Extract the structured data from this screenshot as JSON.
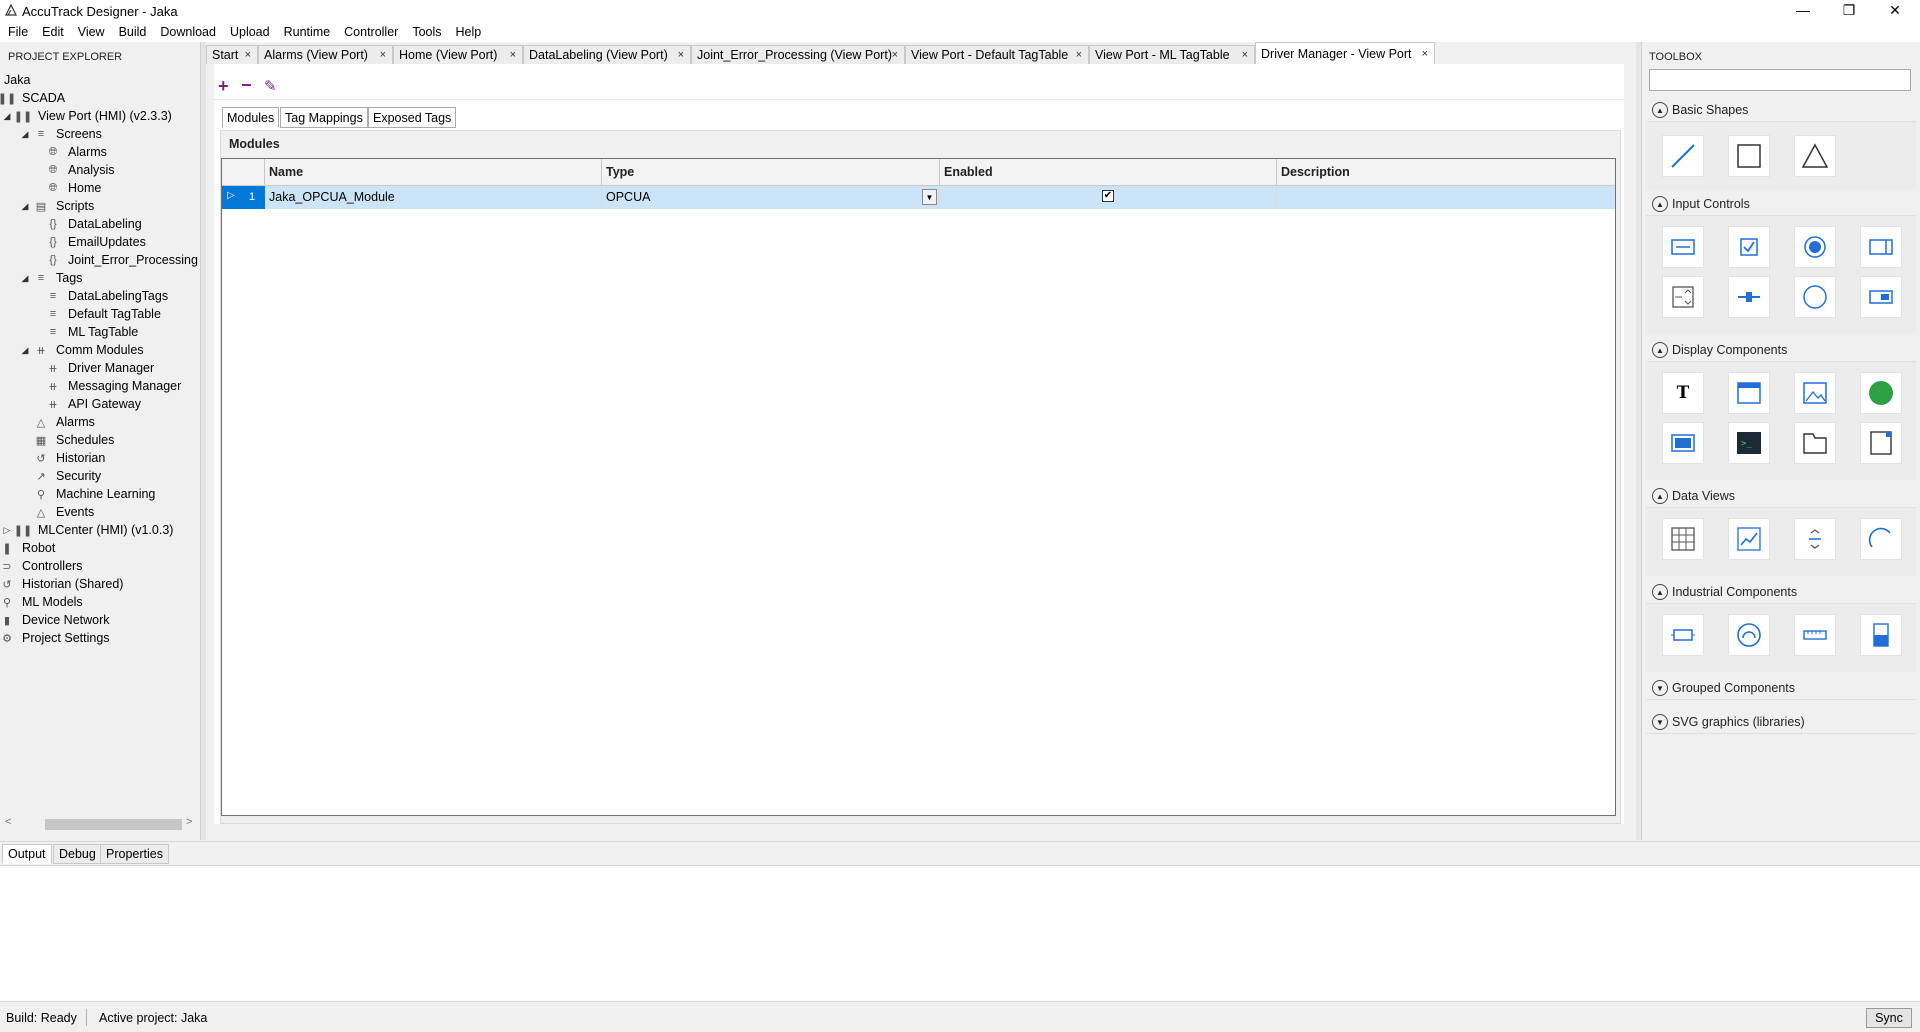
{
  "window": {
    "title": "AccuTrack Designer - Jaka"
  },
  "menu": [
    "File",
    "Edit",
    "View",
    "Build",
    "Download",
    "Upload",
    "Runtime",
    "Controller",
    "Tools",
    "Help"
  ],
  "explorer": {
    "header": "PROJECT EXPLORER",
    "root": "Jaka",
    "items": {
      "scada": "SCADA",
      "viewport": "View Port (HMI) (v2.3.3)",
      "screens": "Screens",
      "alarms_screen": "Alarms",
      "analysis": "Analysis",
      "home": "Home",
      "scripts": "Scripts",
      "datalabeling": "DataLabeling",
      "emailupdates": "EmailUpdates",
      "joint_error": "Joint_Error_Processing",
      "tags": "Tags",
      "datalabelingtags": "DataLabelingTags",
      "default_tagtable": "Default TagTable",
      "ml_tagtable": "ML TagTable",
      "comm_modules": "Comm Modules",
      "driver_manager": "Driver Manager",
      "messaging_manager": "Messaging Manager",
      "api_gateway": "API Gateway",
      "alarms": "Alarms",
      "schedules": "Schedules",
      "historian": "Historian",
      "security": "Security",
      "machine_learning": "Machine Learning",
      "events": "Events",
      "mlcenter": "MLCenter (HMI) (v1.0.3)",
      "robot": "Robot",
      "controllers": "Controllers",
      "historian_shared": "Historian (Shared)",
      "ml_models": "ML Models",
      "device_network": "Device Network",
      "project_settings": "Project Settings"
    }
  },
  "doc_tabs": [
    "Start",
    "Alarms (View Port)",
    "Home (View Port)",
    "DataLabeling (View Port)",
    "Joint_Error_Processing (View Port)",
    "View Port - Default TagTable",
    "View Port - ML TagTable",
    "Driver Manager - View Port"
  ],
  "editor": {
    "subtabs": [
      "Modules",
      "Tag Mappings",
      "Exposed Tags"
    ],
    "panel_label": "Modules",
    "columns": [
      "Name",
      "Type",
      "Enabled",
      "Description"
    ],
    "rows": [
      {
        "index": "1",
        "name": "Jaka_OPCUA_Module",
        "type": "OPCUA",
        "enabled": true,
        "description": ""
      }
    ]
  },
  "toolbox": {
    "header": "TOOLBOX",
    "search_value": "",
    "sections": {
      "basic_shapes": "Basic Shapes",
      "input_controls": "Input Controls",
      "display_components": "Display Components",
      "data_views": "Data Views",
      "industrial_components": "Industrial Components",
      "grouped_components": "Grouped Components",
      "svg_graphics": "SVG graphics (libraries)"
    }
  },
  "output": {
    "tabs": [
      "Output",
      "Debug",
      "Properties"
    ]
  },
  "status": {
    "build": "Build: Ready",
    "active_project": "Active project: Jaka",
    "sync": "Sync"
  },
  "colors": {
    "accent": "#0078d7",
    "selection": "#cce4f7",
    "toolbar_icon": "#7a1f7a"
  }
}
